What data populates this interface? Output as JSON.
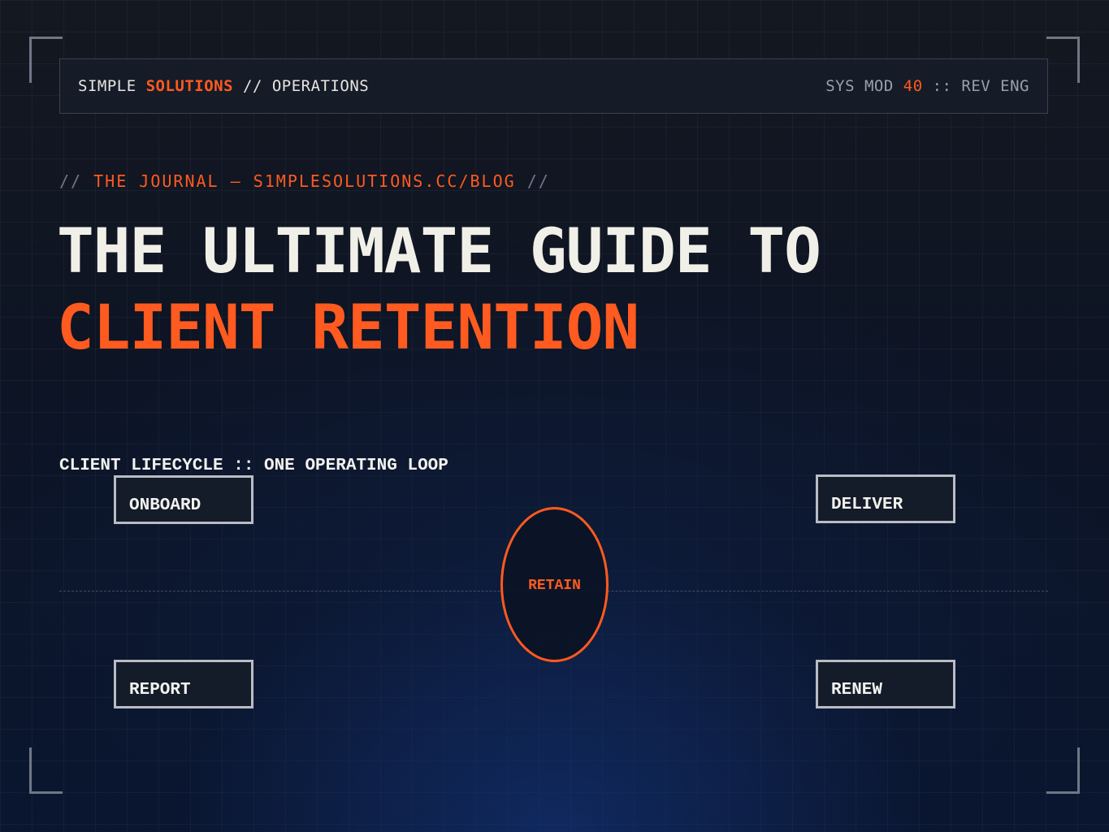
{
  "header": {
    "brand_simple": "SIMPLE",
    "brand_solutions": "SOLUTIONS",
    "brand_section": "// OPERATIONS",
    "sys_prefix": "SYS MOD",
    "sys_number": "40",
    "sys_suffix": ":: REV ENG"
  },
  "kicker": {
    "open": "//",
    "text": "THE JOURNAL — S1MPLESOLUTIONS.CC/BLOG",
    "close": "//"
  },
  "title": {
    "line1": "THE ULTIMATE GUIDE TO",
    "line2": "CLIENT RETENTION"
  },
  "diagram": {
    "label": "CLIENT LIFECYCLE :: ONE OPERATING LOOP",
    "center": "RETAIN",
    "nodes": {
      "onboard": "ONBOARD",
      "deliver": "DELIVER",
      "report": "REPORT",
      "renew": "RENEW"
    }
  },
  "colors": {
    "accent": "#ff5a1f",
    "background": "#0b1120",
    "text": "#f1f0e8",
    "node_border": "#b9bcc4"
  }
}
